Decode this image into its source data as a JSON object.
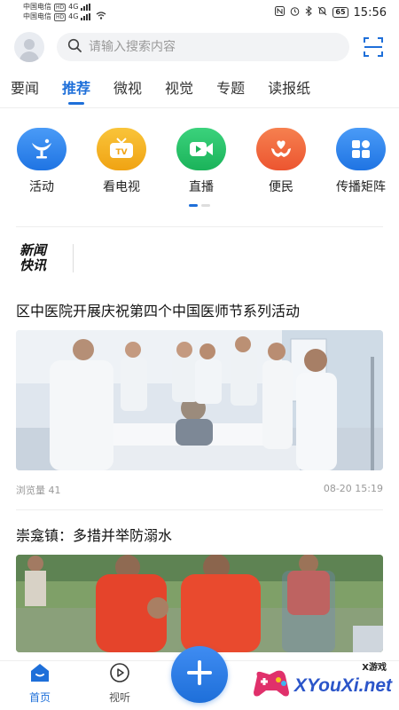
{
  "status_bar": {
    "carrier_1": "中国电信",
    "carrier_2": "中国电信",
    "hd_badge": "HD",
    "network_4g": "4G",
    "battery": "65",
    "time": "15:56"
  },
  "search": {
    "placeholder": "请输入搜索内容"
  },
  "tabs": [
    {
      "label": "要闻"
    },
    {
      "label": "推荐"
    },
    {
      "label": "微视"
    },
    {
      "label": "视觉"
    },
    {
      "label": "专题"
    },
    {
      "label": "读报纸"
    }
  ],
  "shortcuts": [
    {
      "label": "活动",
      "icon": "activity-icon",
      "color": "#2f86f0"
    },
    {
      "label": "看电视",
      "icon": "tv-icon",
      "color": "#f5b21d"
    },
    {
      "label": "直播",
      "icon": "live-camera-icon",
      "color": "#27c46b"
    },
    {
      "label": "便民",
      "icon": "service-heart-icon",
      "color": "#f2683f"
    },
    {
      "label": "传播矩阵",
      "icon": "matrix-grid-icon",
      "color": "#2f86f0"
    }
  ],
  "flash": {
    "logo_line1": "新闻",
    "logo_line2": "快讯"
  },
  "news": [
    {
      "title": "区中医院开展庆祝第四个中国医师节系列活动",
      "views": "浏览量 41",
      "time": "08-20 15:19",
      "image": "hospital-doctors-photo"
    },
    {
      "title": "崇龛镇：多措并举防溺水",
      "image": "rescue-life-jacket-photo"
    }
  ],
  "bottom_nav": {
    "home": "首页",
    "listen": "视听",
    "plus_icon": "plus-icon"
  },
  "watermark": {
    "text": "XYouXi.net",
    "small": "X游戏"
  },
  "colors": {
    "accent": "#1e6fd9"
  }
}
